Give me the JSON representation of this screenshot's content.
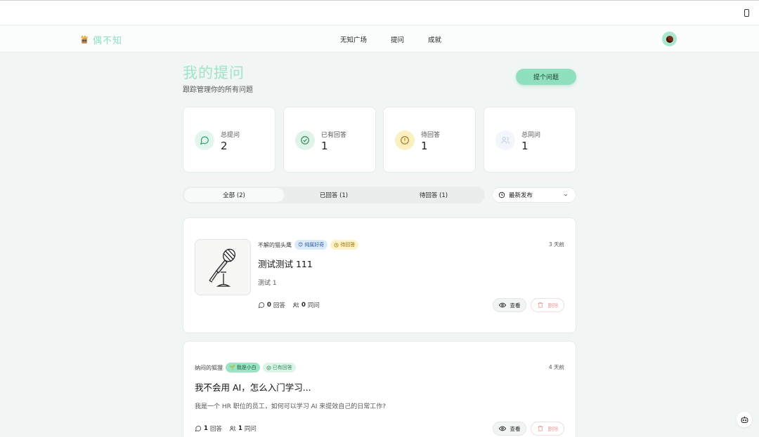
{
  "nav": {
    "logo_text": "偶不知",
    "links": [
      "无知广场",
      "提问",
      "成就"
    ]
  },
  "header": {
    "title": "我的提问",
    "subtitle": "跟踪管理你的所有问题",
    "ask_button": "提个问题"
  },
  "stats": [
    {
      "label": "总提问",
      "value": "2",
      "icon": "message-circle-icon",
      "color": "#e3f6ee"
    },
    {
      "label": "已有回答",
      "value": "1",
      "icon": "check-circle-icon",
      "color": "#dff3e8"
    },
    {
      "label": "待回答",
      "value": "1",
      "icon": "alert-circle-icon",
      "color": "#fbf0c2"
    },
    {
      "label": "总同问",
      "value": "1",
      "icon": "users-icon",
      "color": "#f3f6fb"
    }
  ],
  "filters": {
    "tabs": [
      "全部 (2)",
      "已回答 (1)",
      "待回答 (1)"
    ],
    "active": 0,
    "sort_label": "最新发布"
  },
  "questions": [
    {
      "author": "不解的猫头鹰",
      "tag": "纯属好奇",
      "tag_icon": "smile-emoji-icon",
      "status": "待回答",
      "time": "3 天前",
      "title": "测试测试 111",
      "desc": "测试 1",
      "answers": "0",
      "answers_label": "回答",
      "same": "0",
      "same_label": "同问",
      "view": "查看",
      "delete": "删除",
      "thumbnail": "microphone-sketch"
    },
    {
      "author": "纳闷的狐狸",
      "tag": "我是小白",
      "tag_icon": "sprout-emoji-icon",
      "status": "已有回答",
      "time": "4 天前",
      "title": "我不会用 AI，怎么入门学习...",
      "desc": "我是一个 HR 职位的员工，如何可以学习 AI 来提效自己的日常工作?",
      "answers": "1",
      "answers_label": "回答",
      "same": "1",
      "same_label": "同问",
      "view": "查看",
      "delete": "删除"
    }
  ],
  "colors": {
    "accent": "#8ee0bf",
    "background": "#f1f6f4",
    "title": "#9fe3c8"
  }
}
